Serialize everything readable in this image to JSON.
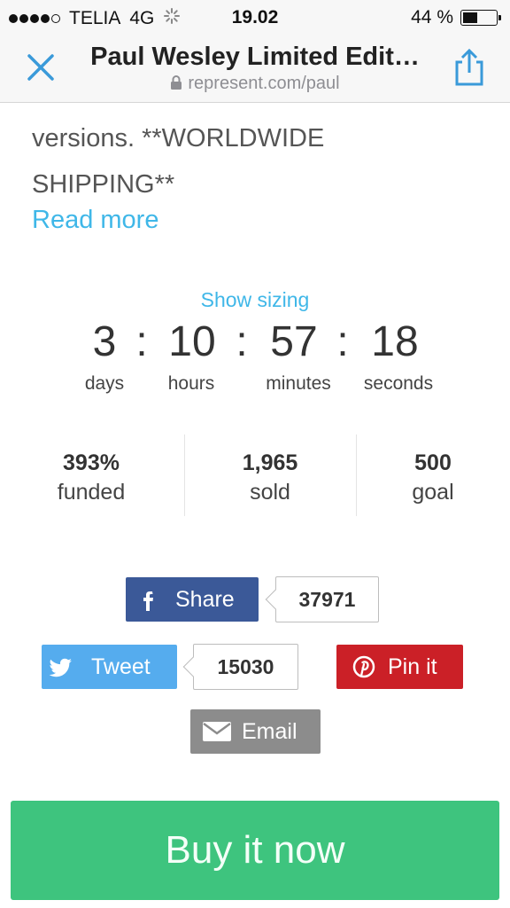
{
  "status_bar": {
    "carrier": "TELIA",
    "network": "4G",
    "time": "19.02",
    "battery_text": "44 %",
    "battery_level": 0.44
  },
  "nav": {
    "title": "Paul Wesley Limited Edit…",
    "url": "represent.com/paul"
  },
  "content": {
    "desc_line1": "versions. **WORLDWIDE",
    "desc_line2": "SHIPPING**",
    "read_more": "Read more",
    "show_sizing": "Show sizing"
  },
  "countdown": {
    "days": "3",
    "hours": "10",
    "minutes": "57",
    "seconds": "18",
    "sep": ":",
    "days_label": "days",
    "hours_label": "hours",
    "minutes_label": "minutes",
    "seconds_label": "seconds"
  },
  "stats": {
    "funded_value": "393%",
    "funded_label": "funded",
    "sold_value": "1,965",
    "sold_label": "sold",
    "goal_value": "500",
    "goal_label": "goal"
  },
  "social": {
    "share_label": "Share",
    "share_count": "37971",
    "tweet_label": "Tweet",
    "tweet_count": "15030",
    "pin_label": "Pin it",
    "email_label": "Email"
  },
  "colors": {
    "accent": "#3fb7e8",
    "facebook": "#3b5998",
    "twitter": "#55acee",
    "pinterest": "#cb2027",
    "email": "#8c8c8c",
    "buy": "#3ec47e"
  },
  "buy_button": "Buy it now"
}
